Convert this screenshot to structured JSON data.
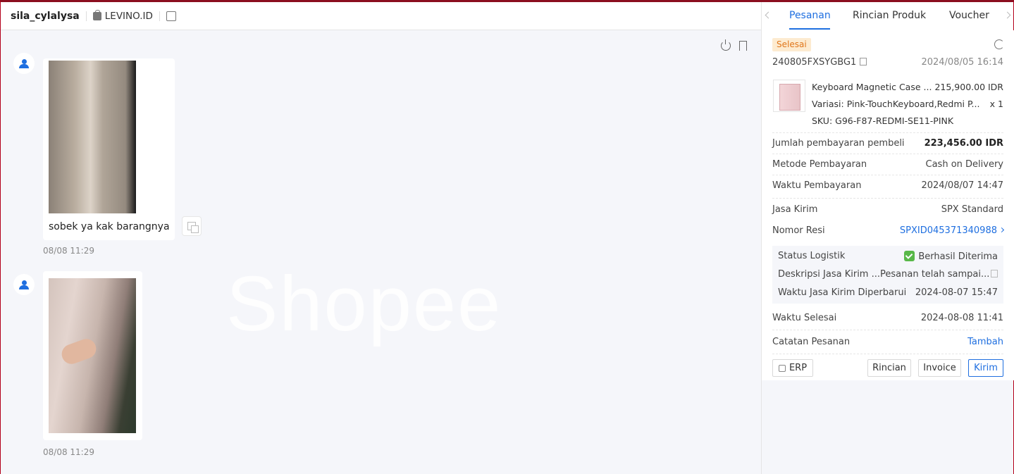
{
  "chat": {
    "username": "sila_cylalysa",
    "shop_name": "LEVINO.ID",
    "watermark": "Shopee",
    "messages": [
      {
        "text": "sobek ya kak barangnya",
        "time": "08/08 11:29"
      },
      {
        "text": "",
        "time": "08/08 11:29"
      }
    ]
  },
  "panel": {
    "tabs": [
      "Pesanan",
      "Rincian Produk",
      "Voucher"
    ],
    "order": {
      "status": "Selesai",
      "order_id": "240805FXSYGBG1",
      "order_date": "2024/08/05 16:14",
      "product": {
        "name": "Keyboard Magnetic Case ...",
        "price": "215,900.00 IDR",
        "variant_label": "Variasi:",
        "variant": "Pink-TouchKeyboard,Redmi P...",
        "qty": "x 1",
        "sku_label": "SKU:",
        "sku": "G96-F87-REDMI-SE11-PINK"
      },
      "details": [
        {
          "label": "Jumlah pembayaran pembeli",
          "value": "223,456.00 IDR"
        },
        {
          "label": "Metode Pembayaran",
          "value": "Cash on Delivery"
        },
        {
          "label": "Waktu Pembayaran",
          "value": "2024/08/07 14:47"
        },
        {
          "label": "Jasa Kirim",
          "value": "SPX Standard"
        },
        {
          "label": "Nomor Resi",
          "value": "SPXID045371340988"
        }
      ],
      "logistics": [
        {
          "label": "Status Logistik",
          "value": "Berhasil Diterima"
        },
        {
          "label": "Deskripsi Jasa Kirim ...",
          "value": "Pesanan telah sampai..."
        },
        {
          "label": "Waktu Jasa Kirim Diperbarui",
          "value": "2024-08-07 15:47"
        }
      ],
      "finish_label": "Waktu Selesai",
      "finish_time": "2024-08-08 11:41",
      "note_label": "Catatan Pesanan",
      "note_action": "Tambah"
    },
    "buttons": {
      "erp": "ERP",
      "detail": "Rincian",
      "invoice": "Invoice",
      "send": "Kirim"
    }
  },
  "colors": {
    "accent": "#1f6fe0",
    "status_bg": "#fdebd0",
    "status_fg": "#e0761a",
    "success": "#58b848"
  }
}
